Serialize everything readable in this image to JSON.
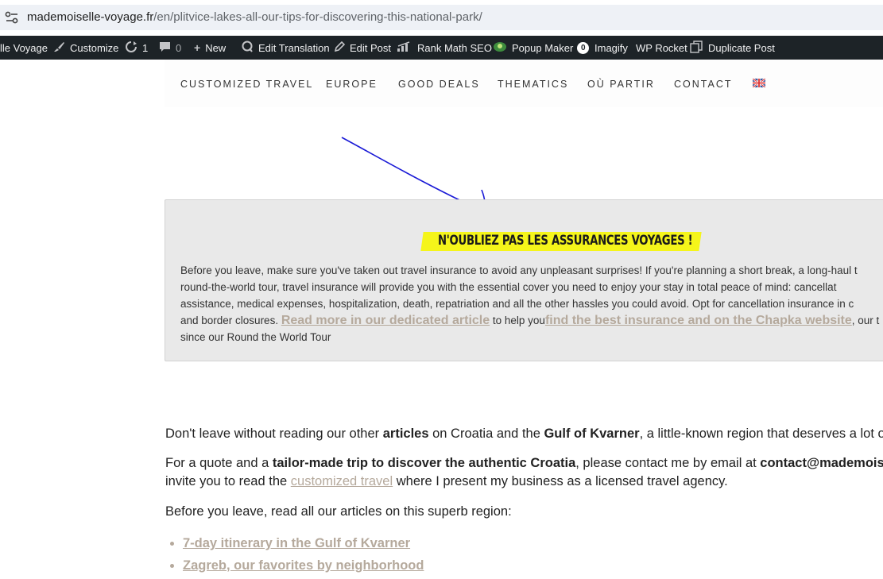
{
  "browser": {
    "url_domain": "mademoiselle-voyage.fr",
    "url_path": "/en/plitvice-lakes-all-our-tips-for-discovering-this-national-park/"
  },
  "admin_bar": {
    "site_name": "lle Voyage",
    "customize": "Customize",
    "updates_count": "1",
    "comments_count": "0",
    "new": "New",
    "edit_translation": "Edit Translation",
    "edit_post": "Edit Post",
    "rank_math": "Rank Math SEO",
    "popup_maker": "Popup Maker",
    "popup_maker_badge": "0",
    "imagify": "Imagify",
    "wp_rocket": "WP Rocket",
    "duplicate_post": "Duplicate Post"
  },
  "nav": {
    "items": [
      "CUSTOMIZED TRAVEL",
      "EUROPE",
      "GOOD DEALS",
      "THEMATICS",
      "OÙ PARTIR",
      "CONTACT"
    ]
  },
  "insurance_box": {
    "heading": "N'OUBLIEZ PAS LES ASSURANCES VOYAGES !",
    "line1": "Before you leave, make sure you've taken out travel insurance to avoid any unpleasant surprises! If you're planning a short break, a long-haul t",
    "line2": "round-the-world tour, travel insurance will provide you with the essential cover you need to enjoy your stay in total peace of mind: cancellat",
    "line3": "assistance, medical expenses, hospitalization, death, repatriation and all the other hassles you could avoid. Opt for cancellation insurance in c",
    "line4_a": "and border closures. ",
    "link_read_more": "Read more in our dedicated article",
    "line4_b": " to help you",
    "link_find": "find the best insurance and on the Chapka website",
    "line4_c": ", our t",
    "line5": "since our Round the World Tour"
  },
  "content": {
    "p1_a": "Don't leave without reading our other ",
    "p1_b": "articles",
    "p1_c": " on Croatia and the ",
    "p1_d": "Gulf of Kvarner",
    "p1_e": ", a little-known region that deserves a lot of",
    "p2_a": "For a quote and a ",
    "p2_b": "tailor-made trip to discover the authentic Croatia",
    "p2_c": ", please contact me by email at ",
    "p2_d": "contact@mademoisel",
    "p3_a": "invite you to read the ",
    "p3_link": "customized travel",
    "p3_b": " where I present my business as a licensed travel agency.",
    "p4": "Before you leave, read all our articles on this superb region:",
    "list": [
      "7-day itinerary in the Gulf of Kvarner",
      "Zagreb, our favorites by neighborhood"
    ]
  },
  "colors": {
    "admin_bar_bg": "#1d2327",
    "highlight": "#f5f51a",
    "link": "#b5a99c",
    "arrow": "#1a1ad6"
  }
}
